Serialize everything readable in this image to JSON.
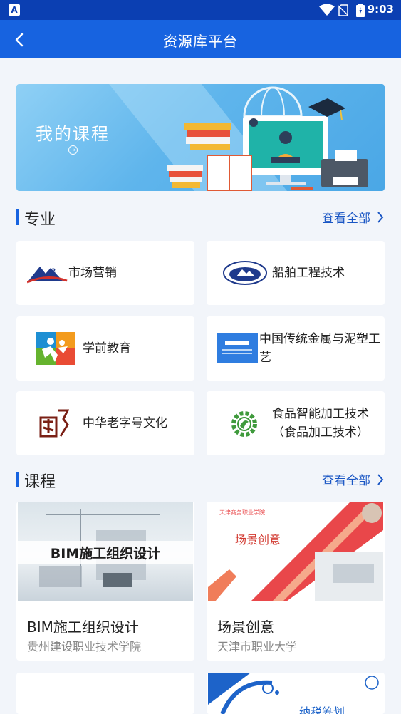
{
  "statusbar": {
    "time": "9:03",
    "app_icon_letter": "A"
  },
  "appbar": {
    "title": "资源库平台"
  },
  "banner": {
    "title": "我的课程"
  },
  "majors": {
    "title": "专业",
    "more": "查看全部",
    "items": [
      {
        "label": "市场营销",
        "icon": "mountain-logo-icon"
      },
      {
        "label": "船舶工程技术",
        "icon": "oval-school-emblem-icon"
      },
      {
        "label": "学前教育",
        "icon": "children-logo-icon"
      },
      {
        "label": "中国传统金属与泥塑工艺",
        "icon": "resource-banner-logo-icon"
      },
      {
        "label": "中华老字号文化",
        "icon": "seal-character-logo-icon"
      },
      {
        "label": "食品智能加工技术（食品加工技术）",
        "icon": "gear-leaf-logo-icon"
      }
    ]
  },
  "courses": {
    "title": "课程",
    "more": "查看全部",
    "items": [
      {
        "name": "BIM施工组织设计",
        "school": "贵州建设职业技术学院",
        "thumb_text": "BIM施工组织设计"
      },
      {
        "name": "场景创意",
        "school": "天津市职业大学",
        "thumb_text": "场景创意",
        "thumb_school": "天津商务职业学院"
      },
      {
        "name": "",
        "school": ""
      },
      {
        "name": "",
        "school": "",
        "thumb_text": "纳税筹划"
      }
    ]
  }
}
